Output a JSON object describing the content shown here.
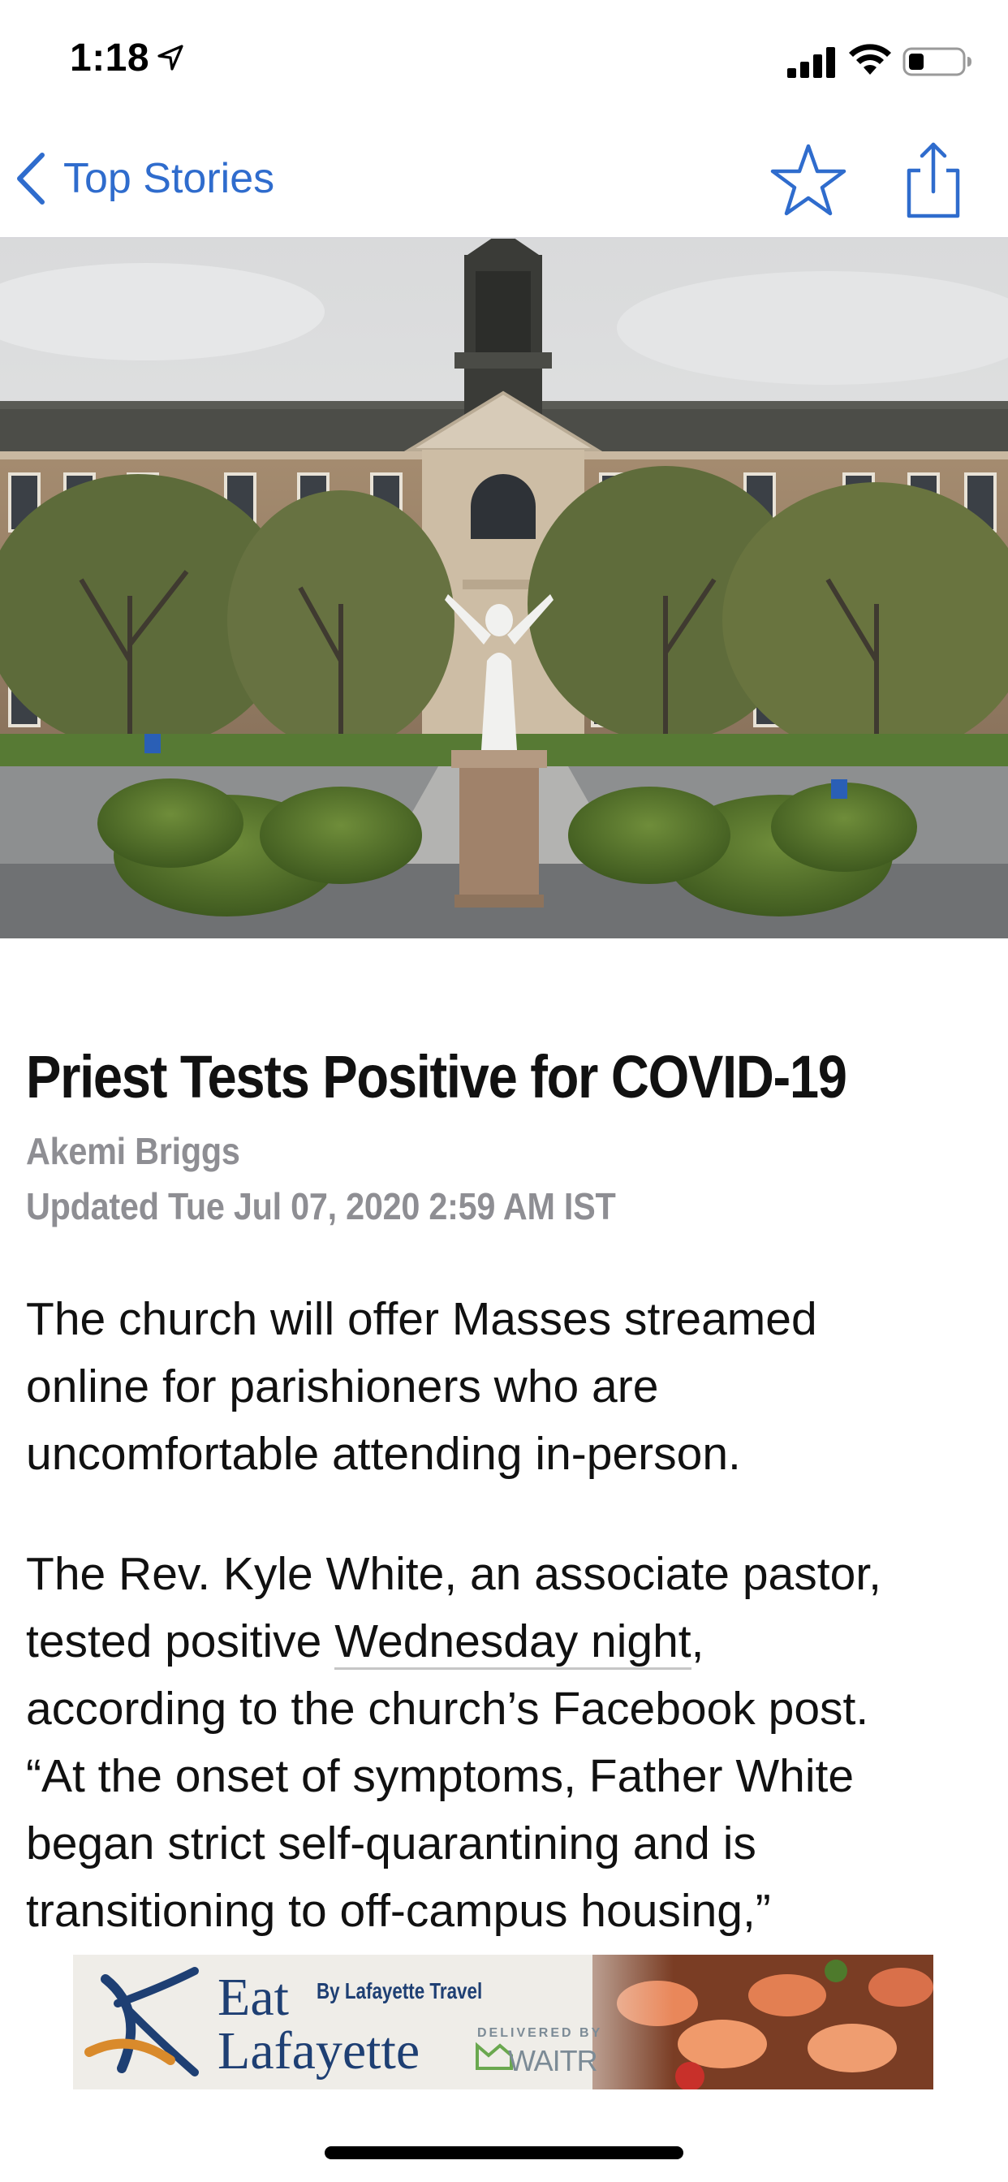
{
  "status_bar": {
    "time": "1:18",
    "location_icon": "location-arrow-icon",
    "signal_icon": "cellular-signal-icon",
    "wifi_icon": "wifi-icon",
    "battery_icon": "battery-icon",
    "battery_level": 0.25
  },
  "nav": {
    "back_icon": "chevron-left-icon",
    "back_label": "Top Stories",
    "star_icon": "star-outline-icon",
    "share_icon": "share-icon",
    "accent_color": "#2f6ccd"
  },
  "hero_image": {
    "subject": "church-building-with-statue"
  },
  "article": {
    "headline": "Priest Tests Positive for COVID-19",
    "author": "Akemi Briggs",
    "updated": "Updated Tue Jul 07, 2020 2:59 AM IST",
    "paragraph_1": [
      "The church will offer Masses streamed",
      "online for parishioners who are",
      "uncomfortable attending in-person."
    ],
    "paragraph_2": {
      "line_1": "The Rev. Kyle White, an associate pastor,",
      "line_2_before": "tested positive ",
      "line_2_link": "Wednesday night",
      "line_2_after": ",",
      "line_3": "according to the church’s Facebook post.",
      "line_4": "“At the onset of symptoms, Father White",
      "line_5": "began strict self-quarantining and is",
      "line_6": "transitioning to off-campus housing,”"
    }
  },
  "ad": {
    "eat": "Eat",
    "by_line": "By Lafayette Travel",
    "lafayette": "Lafayette",
    "delivered_by": "DELIVERED BY",
    "partner": "WAITR",
    "brand_color": "#1e3f73"
  }
}
